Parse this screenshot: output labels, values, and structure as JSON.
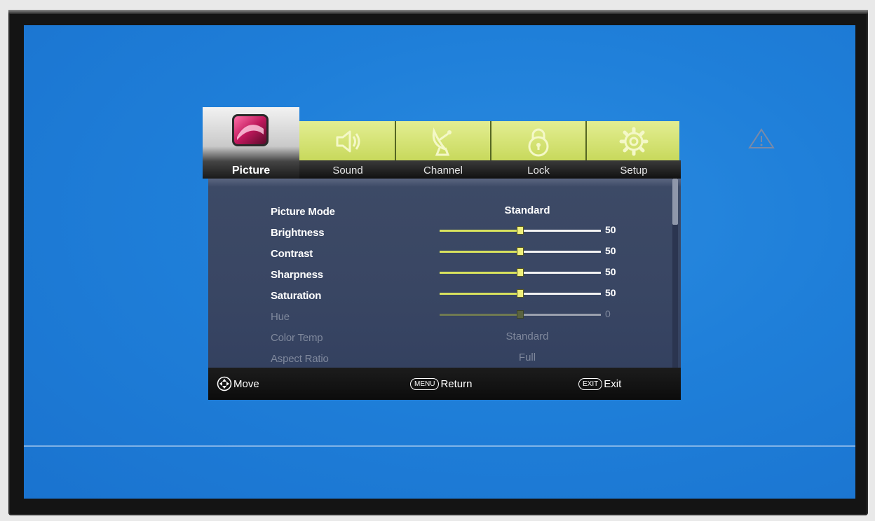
{
  "tabs": [
    {
      "label": "Picture",
      "icon": "picture-icon",
      "active": true
    },
    {
      "label": "Sound",
      "icon": "speaker-icon"
    },
    {
      "label": "Channel",
      "icon": "satellite-dish-icon"
    },
    {
      "label": "Lock",
      "icon": "lock-icon"
    },
    {
      "label": "Setup",
      "icon": "gear-icon"
    }
  ],
  "menu": {
    "picture_mode": {
      "label": "Picture Mode",
      "value": "Standard"
    },
    "brightness": {
      "label": "Brightness",
      "value": 50,
      "display": "50"
    },
    "contrast": {
      "label": "Contrast",
      "value": 50,
      "display": "50"
    },
    "sharpness": {
      "label": "Sharpness",
      "value": 50,
      "display": "50"
    },
    "saturation": {
      "label": "Saturation",
      "value": 50,
      "display": "50"
    },
    "hue": {
      "label": "Hue",
      "value": 0,
      "display": "0",
      "disabled": true
    },
    "color_temp": {
      "label": "Color Temp",
      "value": "Standard",
      "disabled": true
    },
    "aspect_ratio": {
      "label": "Aspect Ratio",
      "value": "Full",
      "disabled": true
    }
  },
  "footer": {
    "move_label": "Move",
    "menu_key": "MENU",
    "return_label": "Return",
    "exit_key": "EXIT",
    "exit_label": "Exit"
  },
  "colors": {
    "screen_blue": "#1f7fd9",
    "tab_yellow": "#d6e274",
    "panel": "#3b4865",
    "slider_fill": "#d8e25e"
  }
}
